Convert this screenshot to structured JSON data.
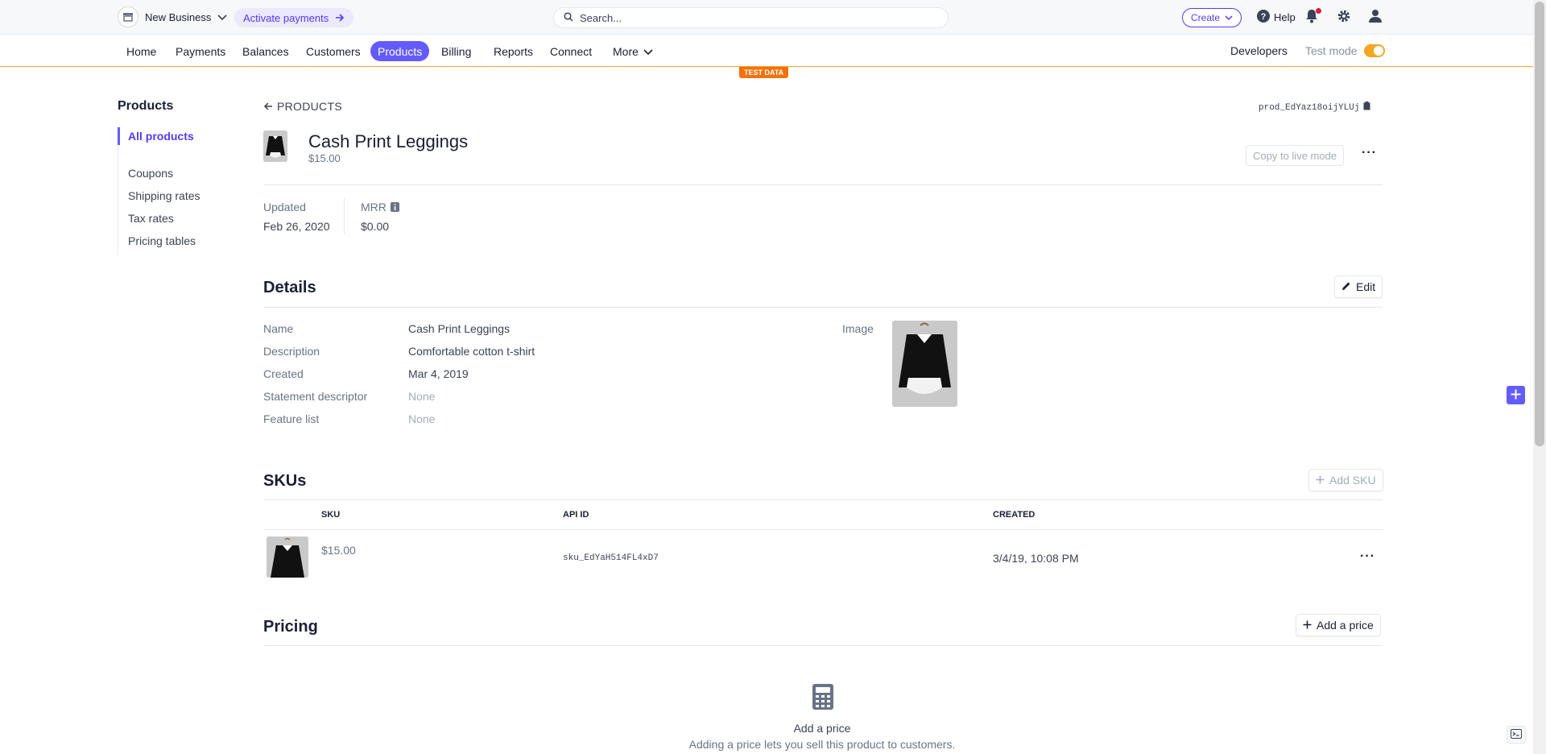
{
  "topbar": {
    "business_name": "New Business",
    "activate_label": "Activate payments",
    "search_placeholder": "Search...",
    "create_label": "Create",
    "help_label": "Help"
  },
  "nav": {
    "items": [
      "Home",
      "Payments",
      "Balances",
      "Customers",
      "Products",
      "Billing",
      "Reports",
      "Connect",
      "More"
    ],
    "active": "Products",
    "developers_label": "Developers",
    "test_mode_label": "Test mode",
    "test_mode_on": true
  },
  "badge": {
    "test_data": "TEST DATA"
  },
  "sidebar": {
    "title": "Products",
    "items": [
      "All products",
      "Coupons",
      "Shipping rates",
      "Tax rates",
      "Pricing tables"
    ]
  },
  "product": {
    "back_label": "PRODUCTS",
    "id": "prod_EdYaz18oijYLUj",
    "name": "Cash Print Leggings",
    "price": "$15.00",
    "copy_live_label": "Copy to live mode",
    "updated_label": "Updated",
    "updated_value": "Feb 26, 2020",
    "mrr_label": "MRR",
    "mrr_value": "$0.00"
  },
  "details": {
    "heading": "Details",
    "edit_label": "Edit",
    "rows": [
      {
        "label": "Name",
        "value": "Cash Print Leggings"
      },
      {
        "label": "Description",
        "value": "Comfortable cotton t-shirt"
      },
      {
        "label": "Created",
        "value": "Mar 4, 2019"
      },
      {
        "label": "Statement descriptor",
        "value": "None"
      },
      {
        "label": "Feature list",
        "value": "None"
      }
    ],
    "image_label": "Image"
  },
  "skus": {
    "heading": "SKUs",
    "add_label": "Add SKU",
    "columns": [
      "SKU",
      "API ID",
      "CREATED"
    ],
    "rows": [
      {
        "sku": "$15.00",
        "api_id": "sku_EdYaH514FL4xD7",
        "created": "3/4/19, 10:08 PM"
      }
    ]
  },
  "pricing": {
    "heading": "Pricing",
    "add_label": "Add a price",
    "empty_title": "Add a price",
    "empty_sub": "Adding a price lets you sell this product to customers."
  },
  "colors": {
    "accent": "#635bff",
    "test_mode": "#f5a623",
    "test_badge": "#f5710b"
  }
}
